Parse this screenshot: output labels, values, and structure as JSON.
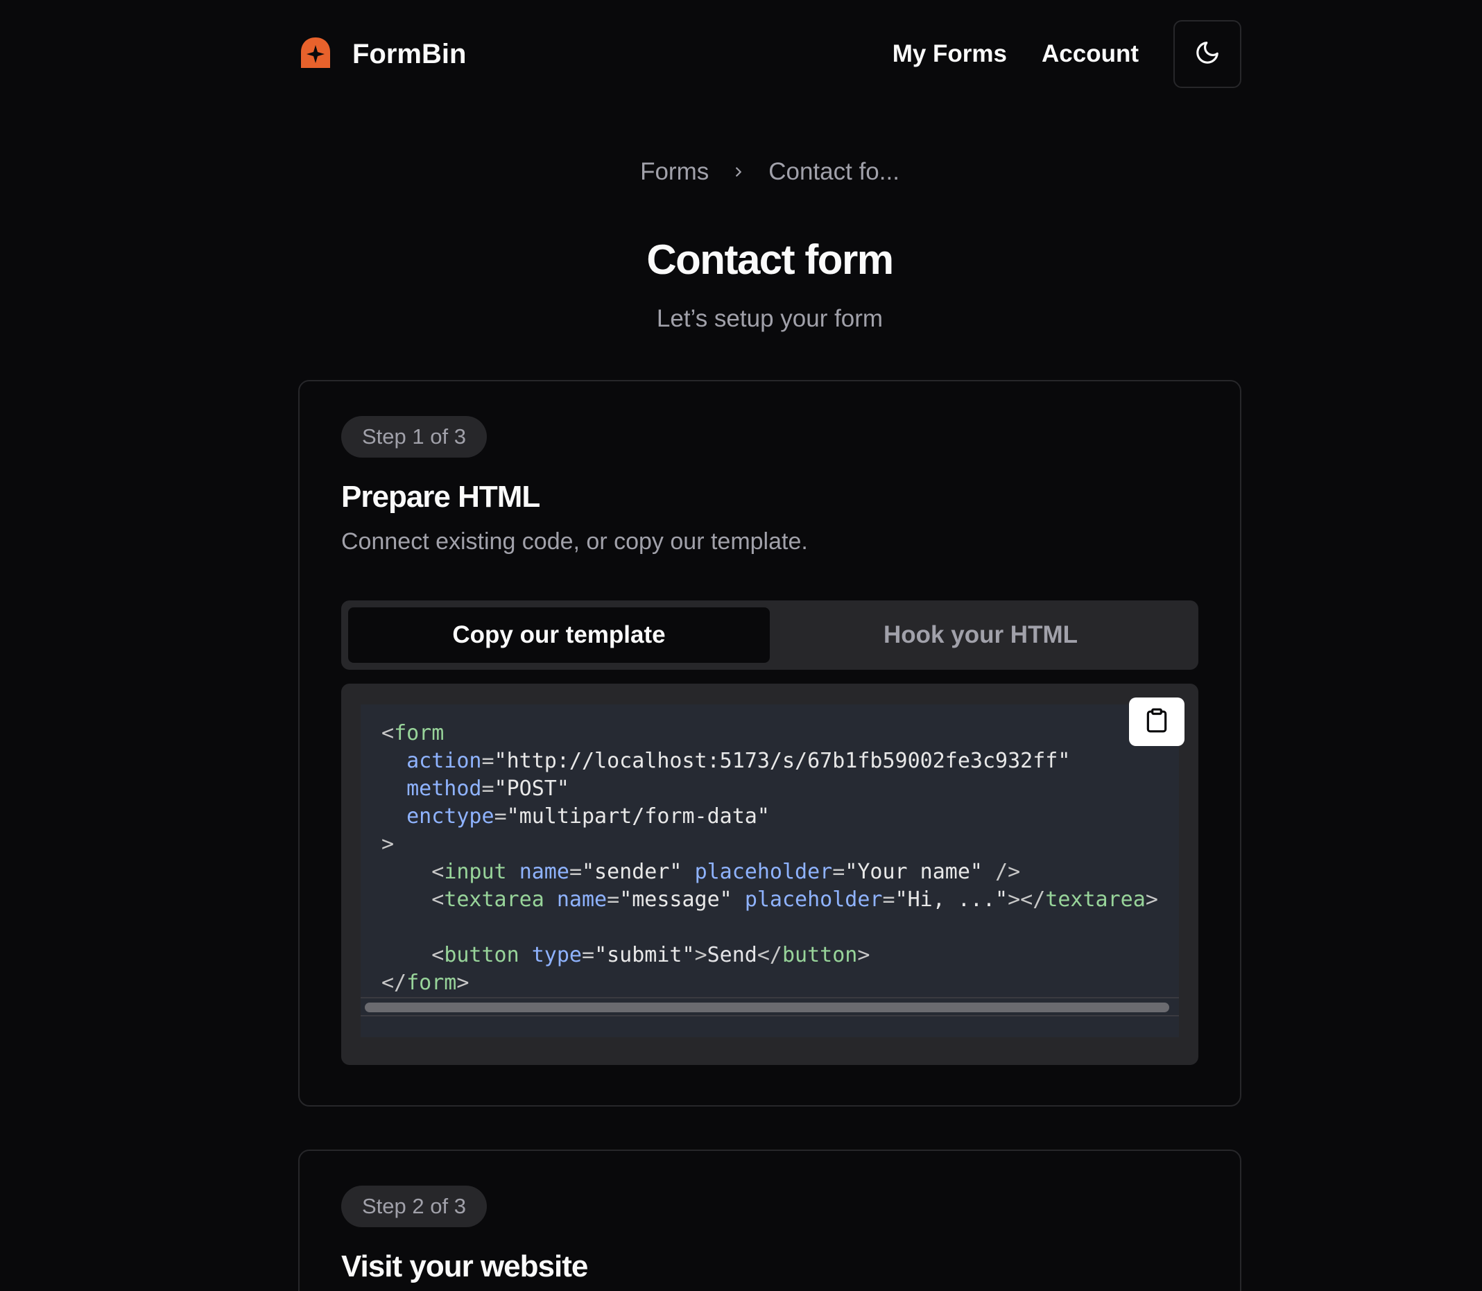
{
  "header": {
    "brand_name": "FormBin",
    "nav": {
      "my_forms": "My Forms",
      "account": "Account"
    },
    "icons": {
      "logo": "formbin-logo-icon",
      "theme": "moon-icon"
    },
    "brand_color": "#e8622c"
  },
  "breadcrumb": {
    "items": [
      "Forms",
      "Contact fo..."
    ]
  },
  "page": {
    "title": "Contact form",
    "subtitle": "Let’s setup your form"
  },
  "steps": [
    {
      "badge": "Step 1 of 3",
      "title": "Prepare HTML",
      "description": "Connect existing code, or copy our template.",
      "tabs": [
        {
          "label": "Copy our template",
          "active": true
        },
        {
          "label": "Hook your HTML",
          "active": false
        }
      ],
      "code": {
        "form_open": "form",
        "action_attr": "action",
        "action_value": "\"http://localhost:5173/s/67b1fb59002fe3c932ff\"",
        "method_attr": "method",
        "method_value": "\"POST\"",
        "enctype_attr": "enctype",
        "enctype_value": "\"multipart/form-data\"",
        "input_tag": "input",
        "input_name_attr": "name",
        "input_name_value": "\"sender\"",
        "input_placeholder_attr": "placeholder",
        "input_placeholder_value": "\"Your name\"",
        "textarea_tag": "textarea",
        "textarea_name_attr": "name",
        "textarea_name_value": "\"message\"",
        "textarea_placeholder_attr": "placeholder",
        "textarea_placeholder_value": "\"Hi, ...\"",
        "button_tag": "button",
        "button_type_attr": "type",
        "button_type_value": "\"submit\"",
        "button_text": "Send",
        "form_close": "form"
      },
      "copy_icon": "clipboard-icon"
    },
    {
      "badge": "Step 2 of 3",
      "title": "Visit your website"
    }
  ]
}
